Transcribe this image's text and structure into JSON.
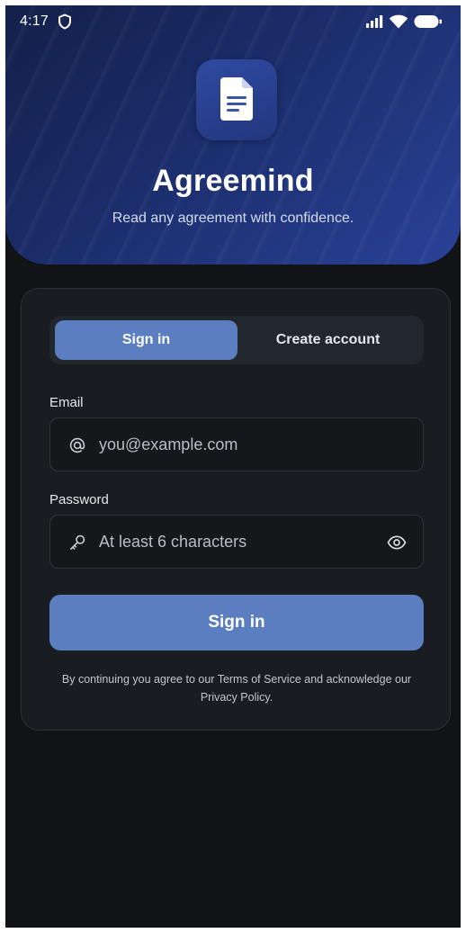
{
  "status_bar": {
    "time": "4:17"
  },
  "header": {
    "title": "Agreemind",
    "subtitle": "Read any agreement with confidence."
  },
  "auth_tabs": {
    "sign_in_label": "Sign in",
    "create_account_label": "Create account",
    "selected": "Sign in"
  },
  "form": {
    "email_label": "Email",
    "email_placeholder": "you@example.com",
    "email_value": "",
    "password_label": "Password",
    "password_placeholder": "At least 6 characters",
    "password_value": ""
  },
  "submit_label": "Sign in",
  "legal_text": "By continuing you agree to our Terms of Service and acknowledge our Privacy Policy.",
  "icons": {
    "status_left": "shield-icon",
    "status_right": [
      "signal-icon",
      "wifi-icon",
      "battery-icon"
    ],
    "app": "document-icon",
    "email": "at-sign-icon",
    "password": "key-icon",
    "reveal": "eye-icon"
  },
  "colors": {
    "accent": "#5b7ec0",
    "background": "#111317",
    "card": "#191c21",
    "hero_start": "#14204a",
    "hero_end": "#2a4197"
  }
}
